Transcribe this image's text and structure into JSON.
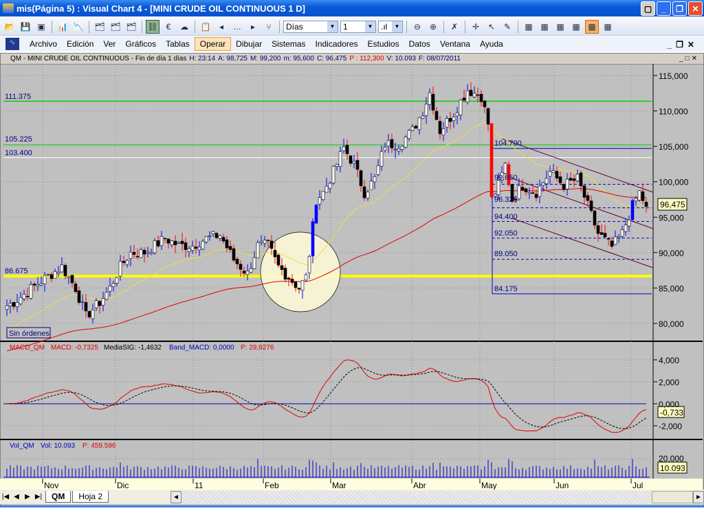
{
  "window": {
    "title": "mis(Página 5) : Visual Chart 4 - [MINI CRUDE OIL CONTINUOUS 1 D]"
  },
  "toolbar": {
    "period": "Días",
    "compression": "1"
  },
  "menu": [
    "Archivo",
    "Edición",
    "Ver",
    "Gráficos",
    "Tablas",
    "Operar",
    "Dibujar",
    "Sistemas",
    "Indicadores",
    "Estudios",
    "Datos",
    "Ventana",
    "Ayuda"
  ],
  "info": {
    "symbol": "QM - MINI CRUDE OIL CONTINUOUS - Fin de día 1 días",
    "h": "H: 23:14",
    "a": "A: 98,725",
    "m": "M: 99,200",
    "mn": "m: 95,600",
    "c": "C: 96,475",
    "p": "P : 112,300",
    "v": "V: 10.093",
    "f": "F: 08/07/2011"
  },
  "price_pane": {
    "levels": {
      "l1": "111.375",
      "l2": "105.225",
      "l3": "103.400",
      "l4": "86.675",
      "r1": "104.700",
      "r2": "99.650",
      "r3": "96.325",
      "r4": "94.400",
      "r5": "92.050",
      "r6": "89.050",
      "r7": "84.175"
    },
    "ticks": [
      "115,000",
      "110,000",
      "105,000",
      "100,000",
      "95,000",
      "90,000",
      "85,000",
      "80,000"
    ],
    "last": "96,475",
    "orders": "Sin órdenes"
  },
  "macd_pane": {
    "name": "MACD_QM",
    "macd": "MACD: -0,7325",
    "sig": "MediaSIG: -1,4632",
    "band": "Band_MACD: 0,0000",
    "p": "P: 29,9276",
    "ticks": [
      "4,000",
      "2,000",
      "0,000",
      "-2,000"
    ],
    "last": "-0,733"
  },
  "vol_pane": {
    "name": "Vol_QM",
    "vol": "Vol: 10.093",
    "p": "P: 459.596",
    "tick": "20,000",
    "last": "10.093"
  },
  "months": [
    "Nov",
    "Dic",
    "11",
    "Feb",
    "Mar",
    "Abr",
    "May",
    "Jun",
    "Jul"
  ],
  "tabs": [
    "QM",
    "Hoja 2"
  ],
  "colors": {
    "up": "#ffffff",
    "down": "#000000",
    "upwick": "#0000ff",
    "downwick": "#ff0000",
    "ma_fast": "#e8e040",
    "ma_slow": "#e00000"
  },
  "chart_data": {
    "type": "candlestick",
    "title": "MINI CRUDE OIL CONTINUOUS 1 D",
    "ylim": [
      77,
      116
    ],
    "note": "approximate daily closes, anchors [bar_index, close]",
    "anchors": [
      [
        0,
        82.5
      ],
      [
        2,
        83
      ],
      [
        10,
        86
      ],
      [
        16,
        88
      ],
      [
        20,
        85
      ],
      [
        23,
        81
      ],
      [
        27,
        83
      ],
      [
        30,
        85
      ],
      [
        33,
        88
      ],
      [
        36,
        90
      ],
      [
        40,
        90
      ],
      [
        46,
        92
      ],
      [
        50,
        91
      ],
      [
        54,
        91
      ],
      [
        58,
        92
      ],
      [
        62,
        92.5
      ],
      [
        66,
        89
      ],
      [
        70,
        87
      ],
      [
        73,
        91
      ],
      [
        76,
        91
      ],
      [
        79,
        88
      ],
      [
        82,
        86.5
      ],
      [
        85,
        85
      ],
      [
        87,
        86.5
      ],
      [
        88,
        89.8
      ],
      [
        90,
        97.5
      ],
      [
        92,
        98.5
      ],
      [
        95,
        101.4
      ],
      [
        98,
        104.8
      ],
      [
        101,
        102.4
      ],
      [
        104,
        98.5
      ],
      [
        107,
        100.4
      ],
      [
        110,
        105.3
      ],
      [
        114,
        105.3
      ],
      [
        118,
        107.2
      ],
      [
        121,
        110
      ],
      [
        123,
        112.6
      ],
      [
        126,
        107.2
      ],
      [
        130,
        109.7
      ],
      [
        134,
        113
      ],
      [
        138,
        112.1
      ],
      [
        140,
        108.2
      ],
      [
        141,
        97.5
      ],
      [
        143,
        99.5
      ],
      [
        145,
        102.4
      ],
      [
        147,
        97.5
      ],
      [
        150,
        99.5
      ],
      [
        154,
        98.5
      ],
      [
        158,
        101.4
      ],
      [
        162,
        99.5
      ],
      [
        166,
        100.4
      ],
      [
        169,
        96.6
      ],
      [
        172,
        92.7
      ],
      [
        176,
        90.8
      ],
      [
        179,
        92.7
      ],
      [
        182,
        96.6
      ],
      [
        184,
        98.5
      ],
      [
        186,
        96.5
      ]
    ]
  }
}
